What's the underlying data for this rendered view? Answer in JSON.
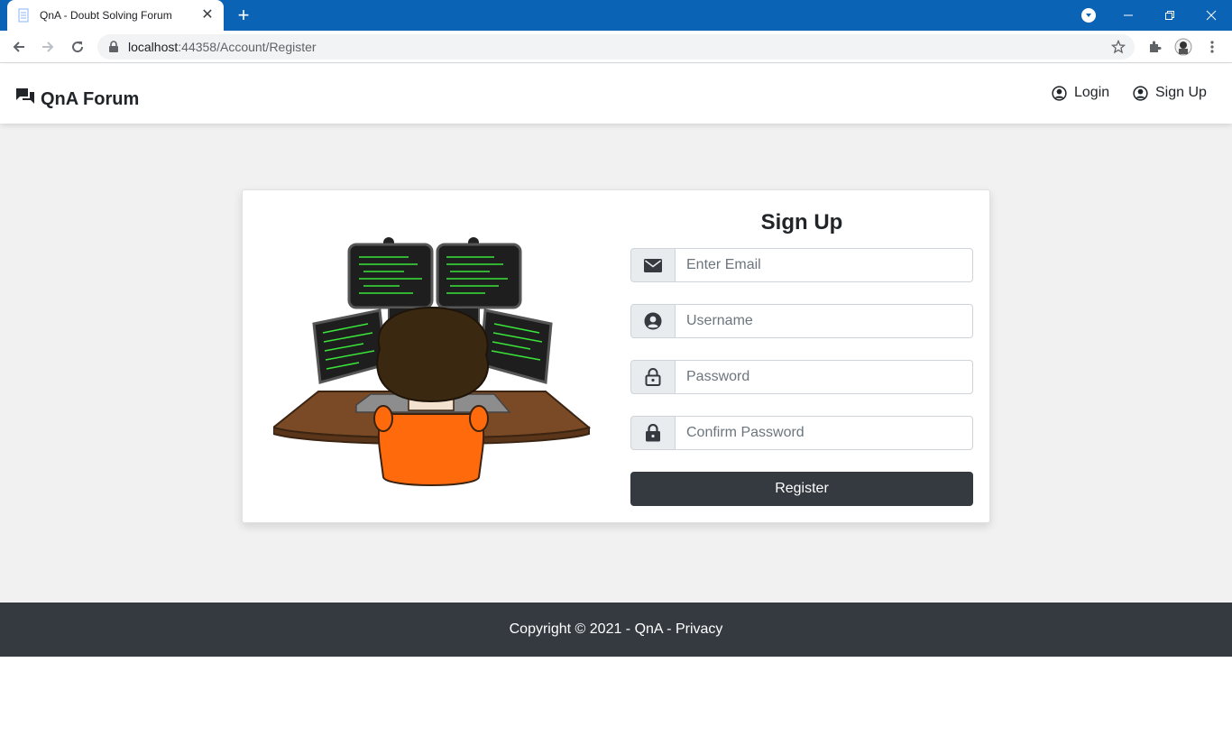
{
  "browser": {
    "tab_title": "QnA - Doubt Solving Forum",
    "url_host": "localhost",
    "url_rest": ":44358/Account/Register"
  },
  "navbar": {
    "brand": "QnA Forum",
    "login_label": "Login",
    "signup_label": "Sign Up"
  },
  "form": {
    "title": "Sign Up",
    "email_placeholder": "Enter Email",
    "username_placeholder": "Username",
    "password_placeholder": "Password",
    "confirm_placeholder": "Confirm Password",
    "register_label": "Register"
  },
  "footer": {
    "copyright": "Copyright © 2021 - QnA - ",
    "privacy_label": "Privacy"
  },
  "colors": {
    "chrome_blue": "#0b63b6",
    "dark": "#343a40",
    "page_bg": "#f1f1f1"
  },
  "icons": [
    "document-icon",
    "close-icon",
    "plus-icon",
    "chevron-down-icon",
    "minimize-icon",
    "restore-icon",
    "close-window-icon",
    "back-arrow-icon",
    "forward-arrow-icon",
    "reload-icon",
    "lock-icon",
    "star-icon",
    "puzzle-icon",
    "avatar",
    "kebab-menu-icon",
    "chat-bubbles-icon",
    "user-circle-icon",
    "envelope-icon",
    "lock-open-icon"
  ]
}
